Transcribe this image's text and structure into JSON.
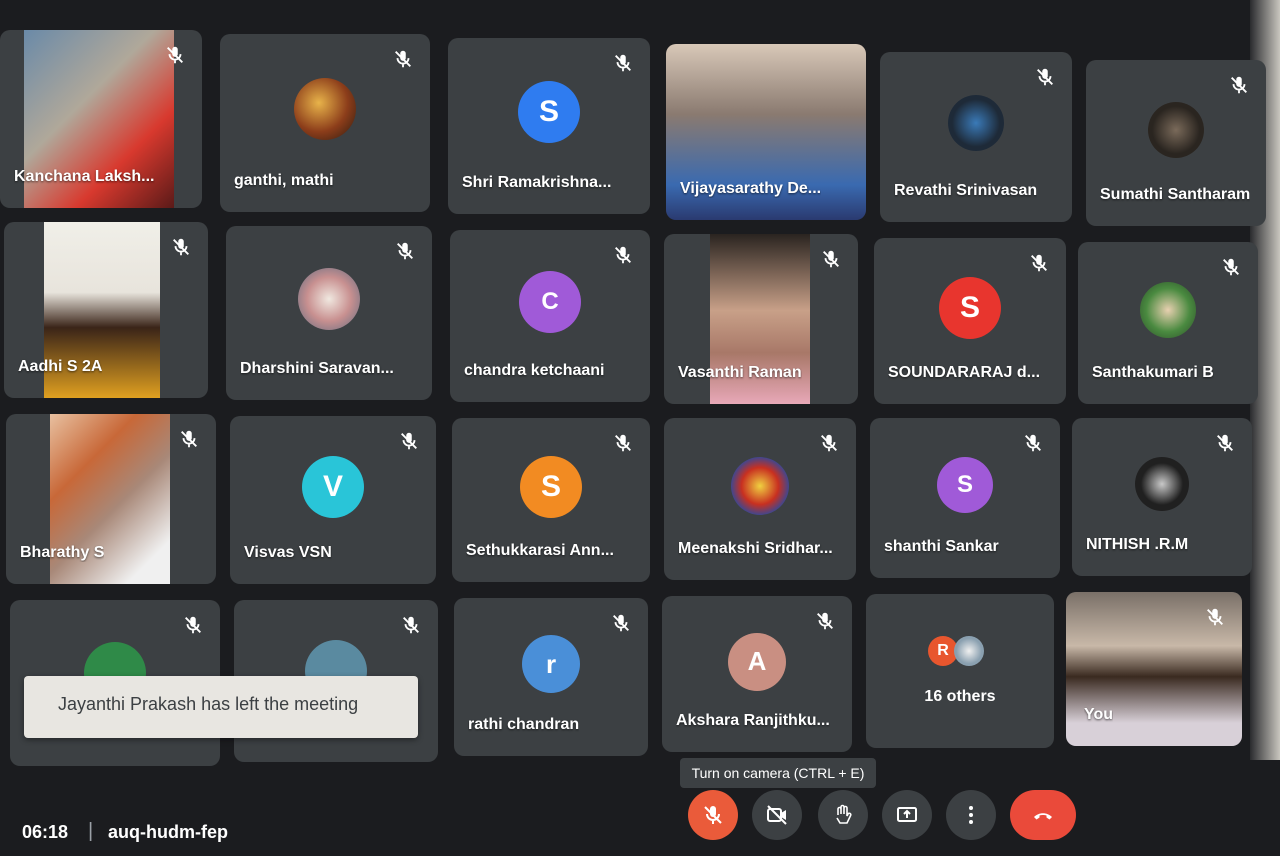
{
  "participants": [
    {
      "name": "Kanchana Laksh..."
    },
    {
      "name": "ganthi, mathi"
    },
    {
      "name": "Shri Ramakrishna...",
      "initial": "S"
    },
    {
      "name": "Vijayasarathy De..."
    },
    {
      "name": "Revathi Srinivasan"
    },
    {
      "name": "Sumathi Santharam"
    },
    {
      "name": "Aadhi S 2A"
    },
    {
      "name": "Dharshini Saravan..."
    },
    {
      "name": "chandra ketchaani",
      "initial": "C"
    },
    {
      "name": "Vasanthi Raman"
    },
    {
      "name": "SOUNDARARAJ d...",
      "initial": "S"
    },
    {
      "name": "Santhakumari B"
    },
    {
      "name": "Bharathy S"
    },
    {
      "name": "Visvas VSN",
      "initial": "V"
    },
    {
      "name": "Sethukkarasi Ann...",
      "initial": "S"
    },
    {
      "name": "Meenakshi Sridhar..."
    },
    {
      "name": "shanthi Sankar",
      "initial": "S"
    },
    {
      "name": "NITHISH .R.M"
    },
    {
      "name": "rathi chandran",
      "initial": "r"
    },
    {
      "name": "Akshara Ranjithku...",
      "initial": "A"
    }
  ],
  "others": {
    "label": "16 others",
    "initial": "R"
  },
  "self": {
    "label": "You"
  },
  "toast": {
    "text": "Jayanthi Prakash has left the meeting"
  },
  "tooltip": {
    "text": "Turn on camera (CTRL + E)"
  },
  "meeting": {
    "time": "06:18",
    "separator": "|",
    "code": "auq-hudm-fep"
  },
  "colors": {
    "tile_bg": "#3c4043",
    "blue_avatar": "#2f7cf0",
    "purple_avatar": "#a05ad8",
    "red_avatar": "#e8352e",
    "cyan_avatar": "#29c5d8",
    "orange_avatar": "#f28b22",
    "steel_avatar": "#4a8fd8",
    "rose_avatar": "#c98f82",
    "others_avatar": "#e8562e",
    "mic_off_button": "#ea5b3a",
    "hangup_button": "#ea4a3a"
  },
  "controls": [
    {
      "icon": "mic-off-icon"
    },
    {
      "icon": "camera-off-icon"
    },
    {
      "icon": "raise-hand-icon"
    },
    {
      "icon": "present-screen-icon"
    },
    {
      "icon": "more-options-icon"
    },
    {
      "icon": "hang-up-icon"
    }
  ]
}
